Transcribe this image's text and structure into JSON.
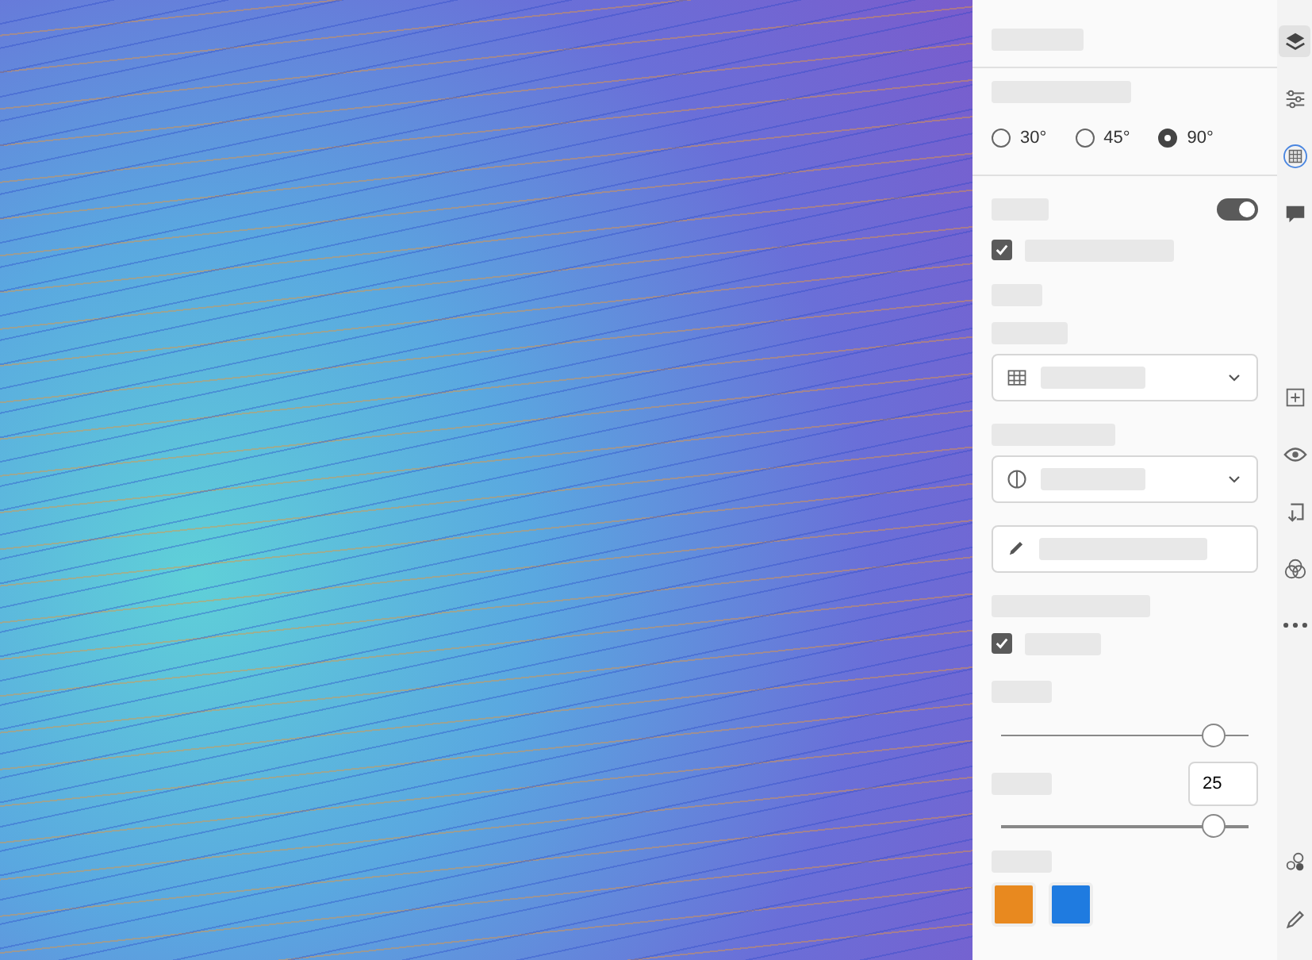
{
  "angle_options": [
    {
      "label": "30°",
      "selected": false
    },
    {
      "label": "45°",
      "selected": false
    },
    {
      "label": "90°",
      "selected": true
    }
  ],
  "grid_toggle": {
    "on": true
  },
  "checkboxes": [
    {
      "checked": true
    },
    {
      "checked": true
    }
  ],
  "sliders": [
    {
      "level": 0.86
    },
    {
      "level": 0.86
    }
  ],
  "size_field": {
    "value": "25"
  },
  "swatches": [
    {
      "color": "#e8891f"
    },
    {
      "color": "#1f7be0"
    }
  ],
  "rail_top": [
    {
      "kind": "layers",
      "selected": true
    },
    {
      "kind": "sliders",
      "selected": false
    },
    {
      "kind": "grid",
      "selected": false
    },
    {
      "kind": "comment",
      "selected": false
    }
  ],
  "rail_middle": [
    {
      "kind": "plus",
      "selected": false
    },
    {
      "kind": "eye",
      "selected": false
    },
    {
      "kind": "import",
      "selected": false
    },
    {
      "kind": "circles",
      "selected": false
    },
    {
      "kind": "more",
      "selected": false
    }
  ],
  "rail_bottom": [
    {
      "kind": "nodes",
      "selected": false
    },
    {
      "kind": "pencil",
      "selected": false
    }
  ]
}
